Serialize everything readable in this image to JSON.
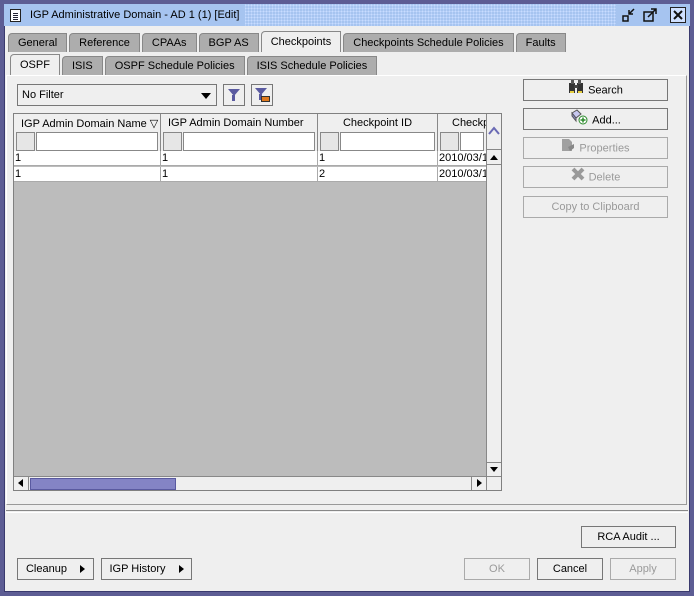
{
  "window": {
    "title": "IGP Administrative Domain - AD 1 (1) [Edit]",
    "controls": [
      "restore-icon",
      "maximize-icon",
      "close-icon"
    ]
  },
  "tabs": [
    {
      "label": "General",
      "active": false
    },
    {
      "label": "Reference",
      "active": false
    },
    {
      "label": "CPAAs",
      "active": false
    },
    {
      "label": "BGP AS",
      "active": false
    },
    {
      "label": "Checkpoints",
      "active": true
    },
    {
      "label": "Checkpoints Schedule Policies",
      "active": false
    },
    {
      "label": "Faults",
      "active": false
    }
  ],
  "subtabs": [
    {
      "label": "OSPF",
      "active": true
    },
    {
      "label": "ISIS",
      "active": false
    },
    {
      "label": "OSPF Schedule Policies",
      "active": false
    },
    {
      "label": "ISIS Schedule Policies",
      "active": false
    }
  ],
  "filter": {
    "selected": "No Filter",
    "icons": [
      "filter-icon",
      "filter-edit-icon"
    ]
  },
  "table": {
    "columns": [
      {
        "label": "IGP Admin Domain Name ▽ (",
        "sorted": "descending"
      },
      {
        "label": "IGP Admin Domain Number"
      },
      {
        "label": "Checkpoint ID"
      },
      {
        "label": "Checkp"
      }
    ],
    "rows": [
      [
        "1",
        "1",
        "1",
        "2010/03/1"
      ],
      [
        "1",
        "1",
        "2",
        "2010/03/1"
      ]
    ]
  },
  "side_buttons": {
    "search": {
      "label": "Search",
      "icon": "binoculars-icon",
      "enabled": true
    },
    "add": {
      "label": "Add...",
      "icon": "add-icon",
      "enabled": true
    },
    "properties": {
      "label": "Properties",
      "icon": "properties-icon",
      "enabled": false
    },
    "delete": {
      "label": "Delete",
      "icon": "delete-icon",
      "enabled": false
    },
    "copy": {
      "label": "Copy to Clipboard",
      "enabled": false
    }
  },
  "footer": {
    "rca_audit": "RCA Audit ...",
    "cleanup": "Cleanup",
    "igp_history": "IGP History",
    "ok": "OK",
    "cancel": "Cancel",
    "apply": "Apply"
  }
}
